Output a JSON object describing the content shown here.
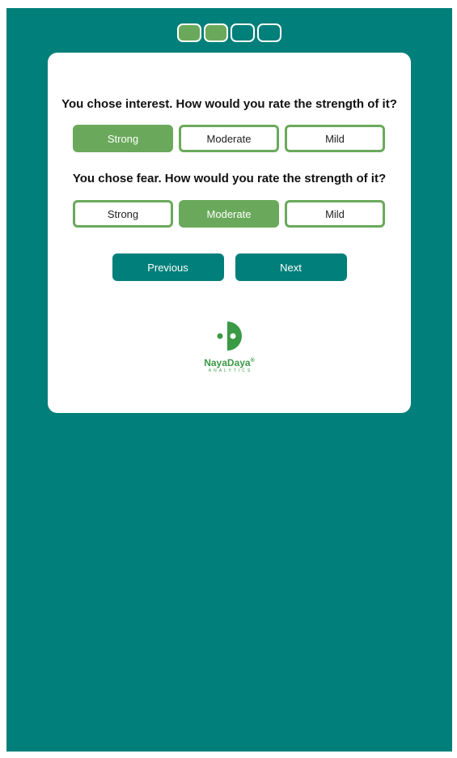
{
  "progress": {
    "steps": [
      {
        "completed": true
      },
      {
        "completed": true
      },
      {
        "completed": false
      },
      {
        "completed": false
      }
    ]
  },
  "questions": [
    {
      "text": "You chose interest. How would you rate the strength of it?",
      "options": [
        "Strong",
        "Moderate",
        "Mild"
      ],
      "selected": "Strong"
    },
    {
      "text": "You chose fear. How would you rate the strength of it?",
      "options": [
        "Strong",
        "Moderate",
        "Mild"
      ],
      "selected": "Moderate"
    }
  ],
  "nav": {
    "previous_label": "Previous",
    "next_label": "Next"
  },
  "logo": {
    "brand": "NayaDaya",
    "registered": "®",
    "tagline": "ANALYTICS"
  },
  "colors": {
    "background": "#017f7a",
    "accent_green": "#6aa95b",
    "brand_green": "#3a9a45",
    "card": "#ffffff"
  }
}
